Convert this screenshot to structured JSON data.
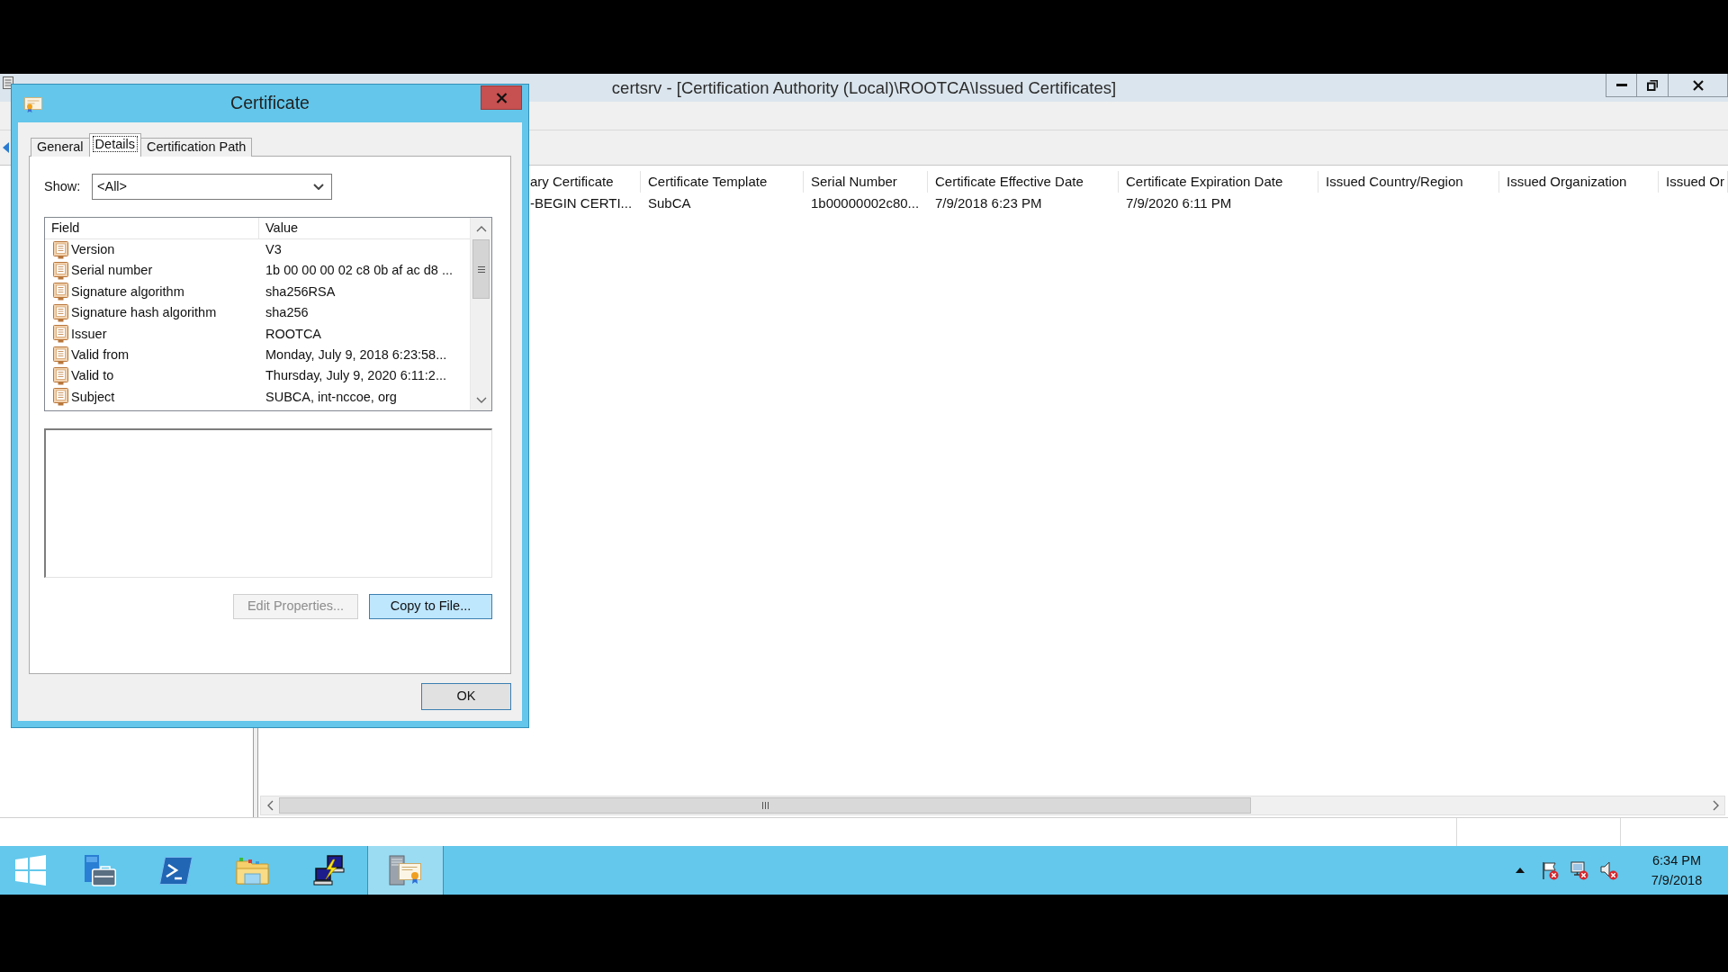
{
  "main_window": {
    "title": "certsrv - [Certification Authority (Local)\\ROOTCA\\Issued Certificates]",
    "table": {
      "columns": [
        "ary Certificate",
        "Certificate Template",
        "Serial Number",
        "Certificate Effective Date",
        "Certificate Expiration Date",
        "Issued Country/Region",
        "Issued Organization",
        "Issued Or"
      ],
      "rows": [
        [
          "-BEGIN CERTI...",
          "SubCA",
          "1b00000002c80...",
          "7/9/2018 6:23 PM",
          "7/9/2020 6:11 PM"
        ]
      ]
    }
  },
  "dialog": {
    "title": "Certificate",
    "tabs": [
      {
        "label": "General",
        "selected": false
      },
      {
        "label": "Details",
        "selected": true
      },
      {
        "label": "Certification Path",
        "selected": false
      }
    ],
    "show": {
      "label": "Show:",
      "value": "<All>"
    },
    "fields_list": {
      "columns": [
        "Field",
        "Value"
      ],
      "rows": [
        {
          "field": "Version",
          "value": "V3"
        },
        {
          "field": "Serial number",
          "value": "1b 00 00 00 02 c8 0b af ac d8 ..."
        },
        {
          "field": "Signature algorithm",
          "value": "sha256RSA"
        },
        {
          "field": "Signature hash algorithm",
          "value": "sha256"
        },
        {
          "field": "Issuer",
          "value": "ROOTCA"
        },
        {
          "field": "Valid from",
          "value": "Monday, July 9, 2018 6:23:58..."
        },
        {
          "field": "Valid to",
          "value": "Thursday, July 9, 2020 6:11:2..."
        },
        {
          "field": "Subject",
          "value": "SUBCA, int-nccoe, org"
        }
      ]
    },
    "buttons": [
      {
        "label": "Edit Properties...",
        "disabled": true,
        "highlighted": false
      },
      {
        "label": "Copy to File...",
        "disabled": false,
        "highlighted": true
      }
    ],
    "ok_button": {
      "label": "OK"
    }
  },
  "taskbar": {
    "apps": [
      {
        "kind": "start",
        "active": false
      },
      {
        "kind": "server-manager",
        "active": false
      },
      {
        "kind": "powershell",
        "active": false
      },
      {
        "kind": "file-explorer",
        "active": false
      },
      {
        "kind": "remote-desktop",
        "active": false
      },
      {
        "kind": "certification-authority",
        "active": true
      }
    ],
    "tray": [
      {
        "kind": "overflow"
      },
      {
        "kind": "flag"
      },
      {
        "kind": "network"
      },
      {
        "kind": "volume"
      }
    ],
    "clock": {
      "time": "6:34 PM",
      "date": "7/9/2018"
    }
  }
}
